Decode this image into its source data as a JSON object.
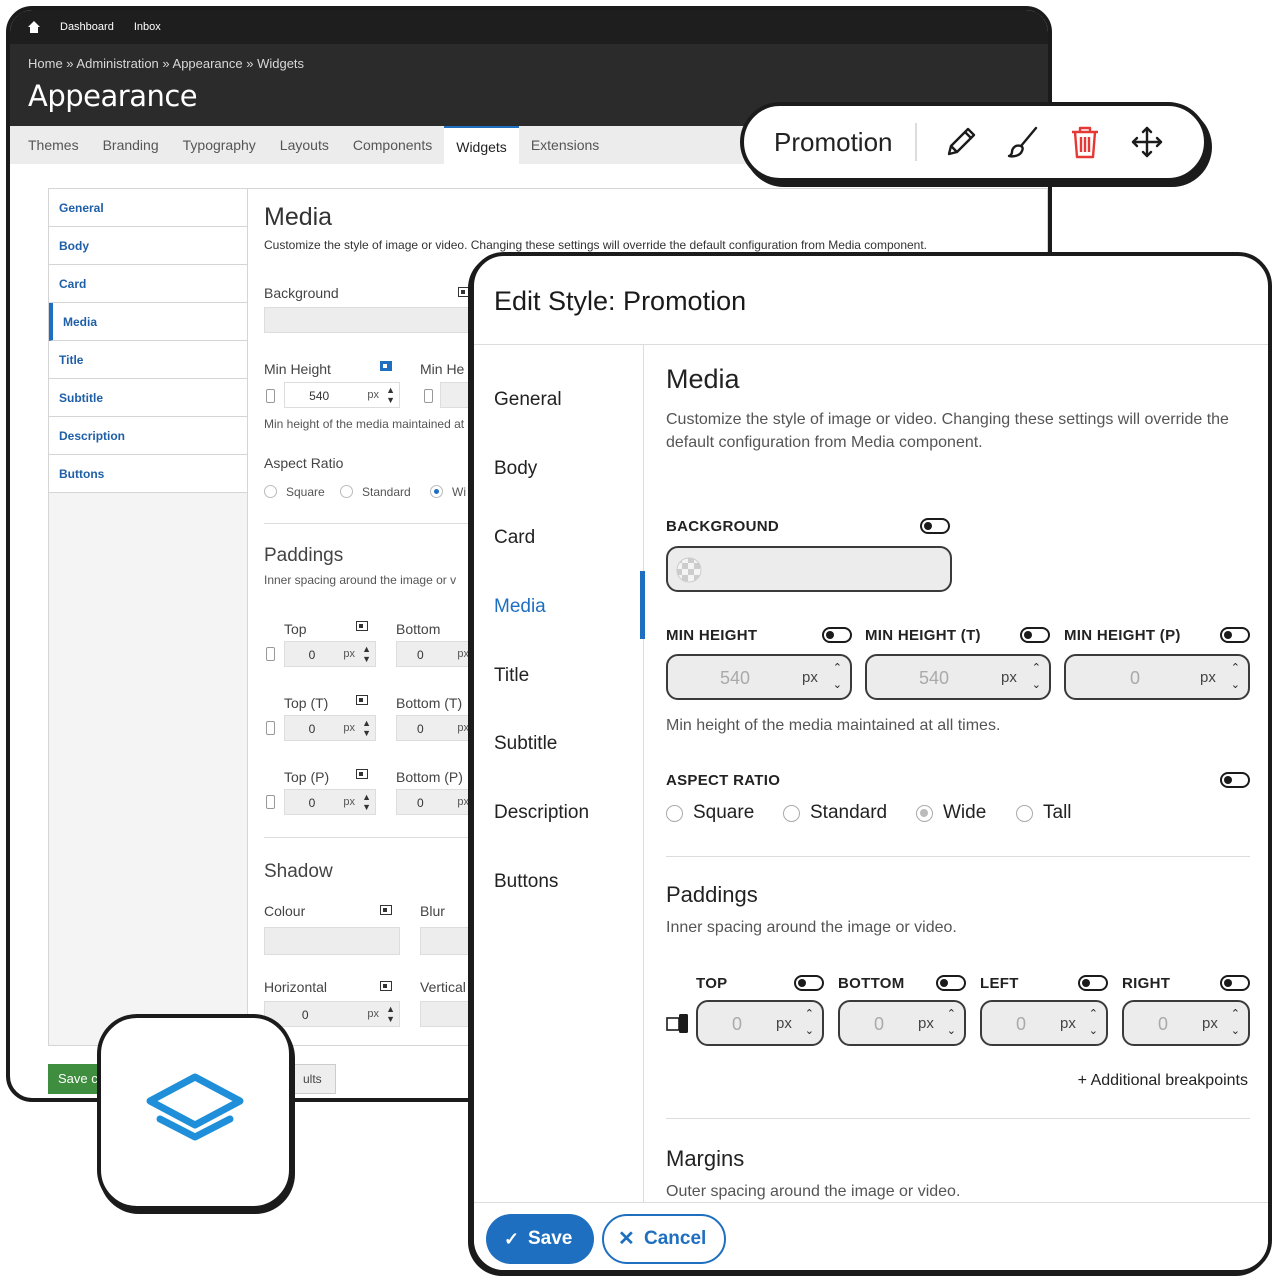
{
  "admin": {
    "topbar": {
      "dashboard": "Dashboard",
      "inbox": "Inbox"
    },
    "breadcrumb": "Home » Administration » Appearance » Widgets",
    "title": "Appearance",
    "tabs": [
      "Themes",
      "Branding",
      "Typography",
      "Layouts",
      "Components",
      "Widgets",
      "Extensions"
    ],
    "active_tab": "Widgets",
    "sidebar": [
      "General",
      "Body",
      "Card",
      "Media",
      "Title",
      "Subtitle",
      "Description",
      "Buttons"
    ],
    "selected_sidebar": "Media",
    "content": {
      "heading": "Media",
      "description": "Customize the style of image or video. Changing these settings will override the default configuration from Media component.",
      "background_label": "Background",
      "min_height_label": "Min Height",
      "min_height_t_label": "Min He",
      "min_height_value": "540",
      "unit": "px",
      "min_height_help": "Min height of the media maintained at",
      "aspect_ratio_label": "Aspect Ratio",
      "aspect_options": [
        "Square",
        "Standard",
        "Wi"
      ],
      "paddings_heading": "Paddings",
      "paddings_desc": "Inner spacing around the image or v",
      "pad_top": "Top",
      "pad_bottom": "Bottom",
      "pad_top_t": "Top (T)",
      "pad_bottom_t": "Bottom (T)",
      "pad_top_p": "Top (P)",
      "pad_bottom_p": "Bottom (P)",
      "zero": "0",
      "shadow_heading": "Shadow",
      "colour_label": "Colour",
      "blur_label": "Blur",
      "horizontal_label": "Horizontal",
      "vertical_label": "Vertical"
    },
    "save_label": "Save c",
    "reset_label": "ults"
  },
  "toolbar": {
    "name": "Promotion",
    "icons": [
      "pencil-icon",
      "brush-icon",
      "trash-icon",
      "move-icon"
    ]
  },
  "dialog": {
    "title": "Edit Style: Promotion",
    "nav": [
      "General",
      "Body",
      "Card",
      "Media",
      "Title",
      "Subtitle",
      "Description",
      "Buttons"
    ],
    "selected_nav": "Media",
    "media": {
      "heading": "Media",
      "description": "Customize the style of image or video. Changing these settings will override the default configuration from Media component.",
      "background_label": "BACKGROUND",
      "min_height_label": "MIN HEIGHT",
      "min_height_t_label": "MIN HEIGHT (T)",
      "min_height_p_label": "MIN HEIGHT (P)",
      "min_height_value": "540",
      "min_height_t_value": "540",
      "min_height_p_value": "0",
      "unit": "px",
      "min_height_help": "Min height of the media maintained at all times.",
      "aspect_ratio_label": "ASPECT RATIO",
      "aspect_options": [
        "Square",
        "Standard",
        "Wide",
        "Tall"
      ],
      "aspect_selected": "Wide"
    },
    "paddings": {
      "heading": "Paddings",
      "description": "Inner spacing around the image or video.",
      "top_label": "TOP",
      "bottom_label": "BOTTOM",
      "left_label": "LEFT",
      "right_label": "RIGHT",
      "value": "0",
      "additional": "+ Additional breakpoints"
    },
    "margins": {
      "heading": "Margins",
      "description": "Outer spacing around the image or video."
    },
    "save_label": "Save",
    "cancel_label": "Cancel"
  },
  "colors": {
    "accent": "#1f6fc0",
    "trash": "#e53935",
    "save_green": "#3f8e3f"
  }
}
